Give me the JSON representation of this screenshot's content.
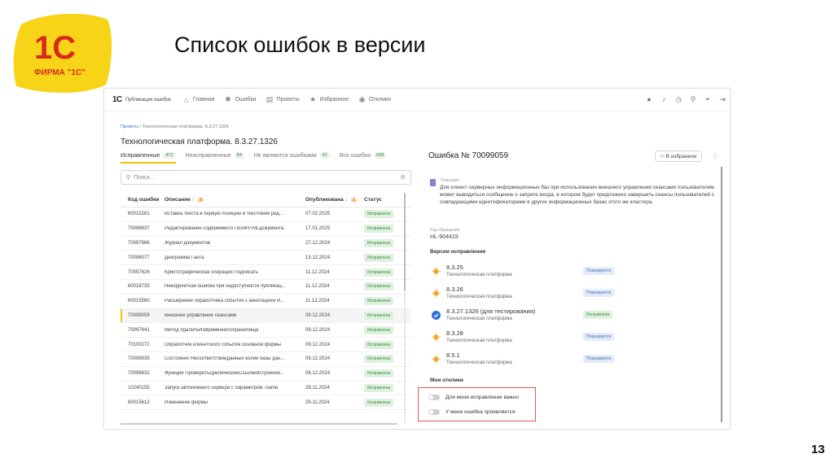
{
  "slide": {
    "title": "Список ошибок в версии",
    "page_number": "13",
    "logo": {
      "brand": "1С",
      "caption": "ФИРМА \"1С\""
    }
  },
  "app": {
    "brand": "1С",
    "brand_sub": "Публикация ошибок",
    "nav": [
      {
        "label": "Главная",
        "icon": "home-icon"
      },
      {
        "label": "Ошибки",
        "icon": "bug-icon"
      },
      {
        "label": "Проекты",
        "icon": "projects-icon"
      },
      {
        "label": "Избранное",
        "icon": "star-icon"
      },
      {
        "label": "Отклики",
        "icon": "check-circle-icon"
      }
    ],
    "breadcrumb": {
      "root": "Проекты",
      "sep": " / ",
      "current": "Технологическая платформа. 8.3.27.1326"
    },
    "title": "Технологическая платформа. 8.3.27.1326",
    "tabs": [
      {
        "label": "Исправленные",
        "count": "472"
      },
      {
        "label": "Неисправленные",
        "count": "84"
      },
      {
        "label": "Не являются ошибками",
        "count": "42"
      },
      {
        "label": "Все ошибки",
        "count": "598"
      }
    ],
    "search": {
      "placeholder": "Поиск..."
    },
    "table": {
      "headers": {
        "code": "Код ошибки",
        "desc": "Описание",
        "desc_badge": "2",
        "published": "Опубликована",
        "pub_badge": "1",
        "status": "Статус"
      },
      "rows": [
        {
          "code": "60015261",
          "desc": "Вставка текста в первую позицию в текстовом ред...",
          "date": "07.02.2025",
          "status": "Исправлена"
        },
        {
          "code": "70086837",
          "desc": "Редактирование содержимого ПоляHTMLДокумента",
          "date": "17.01.2025",
          "status": "Исправлена"
        },
        {
          "code": "70097666",
          "desc": "Журнал документов",
          "date": "27.12.2024",
          "status": "Исправлена"
        },
        {
          "code": "70086077",
          "desc": "Диаграмма Ганта",
          "date": "13.12.2024",
          "status": "Исправлена"
        },
        {
          "code": "70097626",
          "desc": "Криптографическая операция Подписать",
          "date": "11.12.2024",
          "status": "Исправлена"
        },
        {
          "code": "60018735",
          "desc": "Некорректная ошибка при недоступности публикац...",
          "date": "11.12.2024",
          "status": "Исправлена"
        },
        {
          "code": "60015560",
          "desc": "Расширение обработчика события с аннотацией И...",
          "date": "11.12.2024",
          "status": "Исправлена"
        },
        {
          "code": "70099059",
          "desc": "Внешнее управление сеансами",
          "date": "09.12.2024",
          "status": "Исправлена"
        },
        {
          "code": "70097641",
          "desc": "Метод УдалитьИзВременногоХранилища",
          "date": "09.12.2024",
          "status": "Исправлена"
        },
        {
          "code": "70100272",
          "desc": "Обработчик клиентского события основной формы",
          "date": "09.12.2024",
          "status": "Исправлена"
        },
        {
          "code": "70096935",
          "desc": "Состояние НесоответствиеДанных колии базы дан...",
          "date": "09.12.2024",
          "status": "Исправлена"
        },
        {
          "code": "70098632",
          "desc": "Функция ПроверитьЦиклическиеСсылкиВстроенно...",
          "date": "06.12.2024",
          "status": "Исправлена"
        },
        {
          "code": "10240155",
          "desc": "Запуск автономного сервера с параметром -name",
          "date": "29.11.2024",
          "status": "Исправлена"
        },
        {
          "code": "60015612",
          "desc": "Изменение формы",
          "date": "29.11.2024",
          "status": "Исправлена"
        }
      ]
    },
    "detail": {
      "title": "Ошибка № 70099059",
      "fav_label": "☆ В избранное",
      "desc_label": "Описание",
      "desc_text": "Для клиент-серверных информационных баз при использовании внешнего управления сеансами пользователям может выводиться сообщение о запрете входа, в котором будет предложено завершить сеансы пользователей с совпадающими идентификаторами в других информационных базах этого же кластера.",
      "code_label": "Код обращения",
      "code_value": "HL-904419",
      "versions_title": "Версии исправления",
      "versions": [
        {
          "name": "8.3.25",
          "sub": "Технологическая платформа",
          "status": "Планируется",
          "kind": "plan"
        },
        {
          "name": "8.3.26",
          "sub": "Технологическая платформа",
          "status": "Планируется",
          "kind": "plan"
        },
        {
          "name": "8.3.27.1326 (для тестирования)",
          "sub": "Технологическая платформа",
          "status": "Исправлена",
          "kind": "fix"
        },
        {
          "name": "8.3.28",
          "sub": "Технологическая платформа",
          "status": "Планируется",
          "kind": "plan"
        },
        {
          "name": "8.5.1",
          "sub": "Технологическая платформа",
          "status": "Планируется",
          "kind": "plan"
        }
      ],
      "feedback_title": "Мои отклики",
      "toggles": [
        {
          "label": "Для меня исправление важно"
        },
        {
          "label": "У меня ошибка проявляется"
        }
      ]
    },
    "colors": {
      "accent": "#f5c400",
      "fixed": "#3a8a3a",
      "planned": "#3f69b0",
      "logo_red": "#d62a1e",
      "logo_yellow": "#f7d417",
      "highlight": "#e05a4a"
    }
  }
}
